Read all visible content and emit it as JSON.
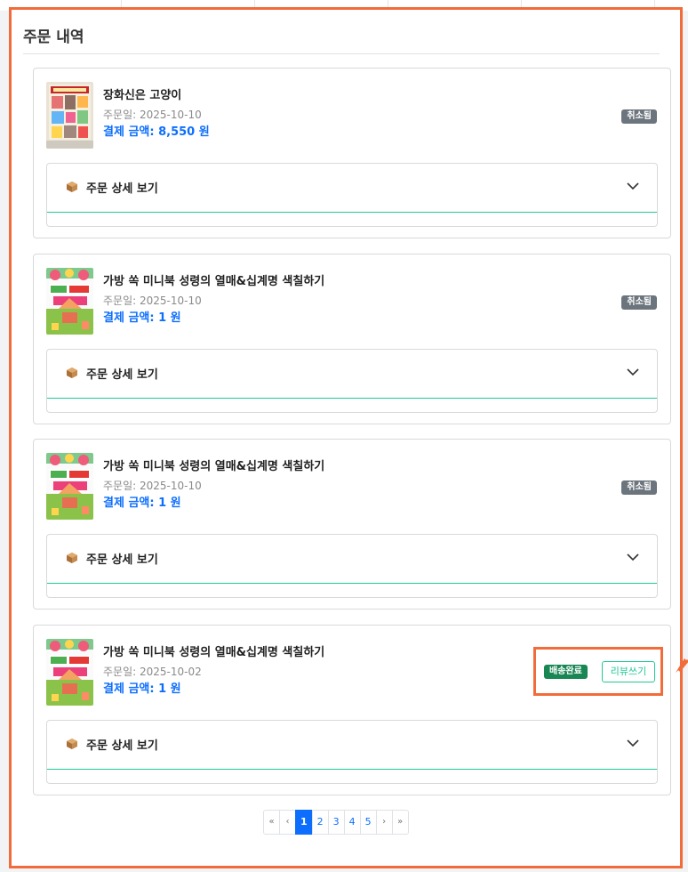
{
  "section": {
    "title": "주문 내역"
  },
  "orders": [
    {
      "title": "장화신은 고양이",
      "date": "주문일: 2025-10-10",
      "amount": "결제 금액: 8,550 원",
      "status": "취소됨",
      "detail_label": "주문 상세 보기"
    },
    {
      "title": "가방 쏙 미니북 성령의 열매&십계명 색칠하기",
      "date": "주문일: 2025-10-10",
      "amount": "결제 금액: 1 원",
      "status": "취소됨",
      "detail_label": "주문 상세 보기"
    },
    {
      "title": "가방 쏙 미니북 성령의 열매&십계명 색칠하기",
      "date": "주문일: 2025-10-10",
      "amount": "결제 금액: 1 원",
      "status": "취소됨",
      "detail_label": "주문 상세 보기"
    },
    {
      "title": "가방 쏙 미니북 성령의 열매&십계명 색칠하기",
      "date": "주문일: 2025-10-02",
      "amount": "결제 금액: 1 원",
      "status": "배송완료",
      "detail_label": "주문 상세 보기",
      "review_label": "리뷰쓰기"
    }
  ],
  "pagination": {
    "first": "«",
    "prev": "‹",
    "pages": [
      "1",
      "2",
      "3",
      "4",
      "5"
    ],
    "current": "1",
    "next": "›",
    "last": "»"
  },
  "colors": {
    "highlight": "#f26b3a",
    "link": "#0d6efd",
    "accent": "#20c997",
    "cancelled": "#6c757d",
    "delivered": "#198754"
  },
  "icons": {
    "detail": "package-icon",
    "toggle": "chevron-down-icon",
    "pointer": "arrow-icon"
  }
}
